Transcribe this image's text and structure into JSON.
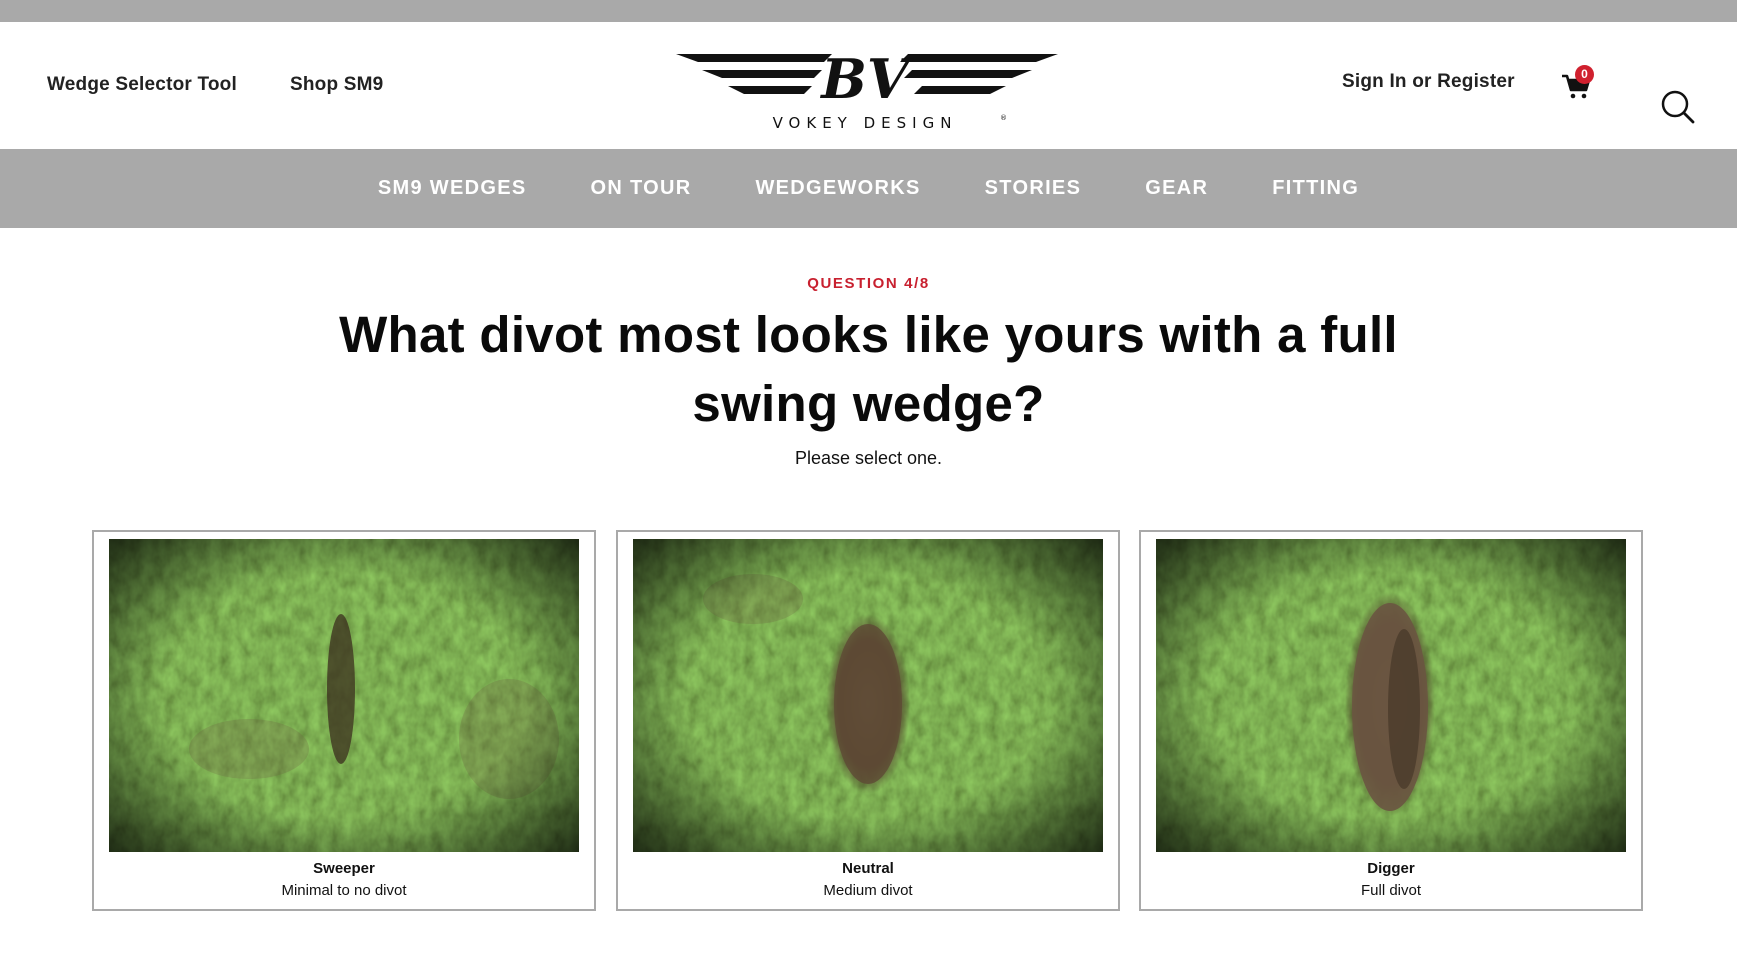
{
  "header": {
    "links": {
      "wedge_selector": "Wedge Selector Tool",
      "shop": "Shop SM9",
      "sign_in": "Sign In or Register"
    },
    "logo": {
      "monogram": "BV",
      "wordmark": "VOKEY DESIGN",
      "registered": "®"
    },
    "cart_count": "0",
    "icons": [
      "cart-icon",
      "search-icon"
    ]
  },
  "nav": {
    "items": [
      "SM9 WEDGES",
      "ON TOUR",
      "WEDGEWORKS",
      "STORIES",
      "GEAR",
      "FITTING"
    ]
  },
  "quiz": {
    "question_label": "QUESTION 4/8",
    "title": "What divot most looks like yours with a full swing wedge?",
    "subtitle": "Please select one.",
    "options": [
      {
        "title": "Sweeper",
        "description": "Minimal to no divot",
        "image": "grass-minimal-divot"
      },
      {
        "title": "Neutral",
        "description": "Medium divot",
        "image": "grass-medium-divot"
      },
      {
        "title": "Digger",
        "description": "Full divot",
        "image": "grass-full-divot"
      }
    ]
  },
  "colors": {
    "accent_red": "#c8202f",
    "nav_gray": "#a9a9a9",
    "badge_red": "#d0202e"
  }
}
